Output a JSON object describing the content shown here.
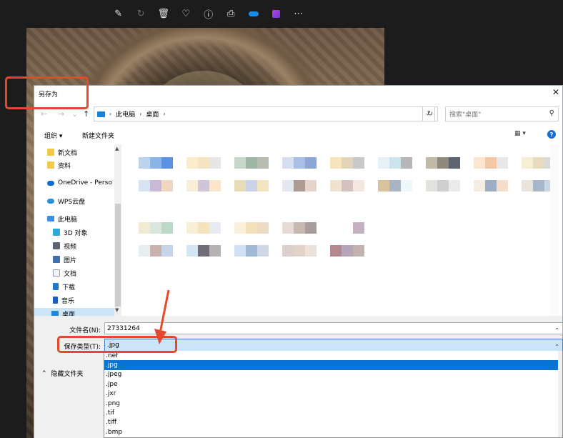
{
  "viewer_toolbar": {
    "icons": [
      "edit-image-icon",
      "rotate-icon",
      "delete-icon",
      "favorite-icon",
      "info-icon",
      "print-icon",
      "onedrive-icon",
      "video-editor-icon",
      "more-icon"
    ]
  },
  "dialog": {
    "title": "另存为",
    "close": "✕",
    "nav": {
      "back": "←",
      "forward": "→",
      "recent": "⌄",
      "up": "↑"
    },
    "breadcrumb": [
      "此电脑",
      "桌面"
    ],
    "breadcrumb_sep": "›",
    "search_placeholder": "搜索\"桌面\"",
    "commands": {
      "organize": "组织 ▾",
      "new_folder": "新建文件夹",
      "view": "▦ ▾",
      "help": "?"
    },
    "nav_items": [
      {
        "label": "新文档",
        "icon": "folder-icon"
      },
      {
        "label": "资料",
        "icon": "folder-icon"
      },
      {
        "label": "OneDrive - Perso",
        "icon": "onedrive-cloud-icon"
      },
      {
        "label": "WPS云盘",
        "icon": "wps-cloud-icon"
      },
      {
        "label": "此电脑",
        "icon": "this-pc-icon"
      },
      {
        "label": "3D 对象",
        "icon": "3d-objects-icon"
      },
      {
        "label": "视频",
        "icon": "videos-icon"
      },
      {
        "label": "图片",
        "icon": "pictures-icon"
      },
      {
        "label": "文档",
        "icon": "documents-icon"
      },
      {
        "label": "下载",
        "icon": "downloads-icon"
      },
      {
        "label": "音乐",
        "icon": "music-icon"
      },
      {
        "label": "桌面",
        "icon": "desktop-icon"
      }
    ],
    "file_name_label": "文件名(N):",
    "file_name_value": "27331264",
    "file_type_label": "保存类型(T):",
    "file_type_value": ".jpg",
    "hide_folders": "隐藏文件夹",
    "file_type_options": [
      ".nef",
      ".jpg",
      ".jpeg",
      ".jpe",
      ".jxr",
      ".png",
      ".tif",
      ".tiff",
      ".bmp"
    ],
    "selected_option_index": 1
  },
  "thumb_colors": [
    [
      "#bcd3ee",
      "#8ab3e6",
      "#5a93e4",
      "#d7e3f2",
      "#c9b8d8",
      "#f1d6c2"
    ],
    [
      "#fbeccb",
      "#f6e3c2",
      "#e6e6e6",
      "#f9efd8",
      "#d0c5d6",
      "#fbe6cc"
    ],
    [
      "#c7d7ca",
      "#9fb6a7",
      "#b8bdb2",
      "#e8dcb8",
      "#c9d3e5",
      "#f2e5c0"
    ],
    [
      "#d6dff0",
      "#a9bfe6",
      "#8ca6d6",
      "#e3e7ef",
      "#b09a94",
      "#e5d5cc"
    ],
    [
      "#f7e4bc",
      "#e3d6b8",
      "#c9c9c9",
      "#eee3cf",
      "#d7c2c2",
      "#f3e7e0"
    ],
    [
      "#e7f2f7",
      "#cbe3ea",
      "#b6b6b6",
      "#d8c39d",
      "#a9b4c6",
      "#eef7fa"
    ],
    [
      "#c0bba8",
      "#8e8a7c",
      "#5f6570",
      "#e4e2dc",
      "#cfcfcf",
      "#eaeaea"
    ],
    [
      "#fce6d0",
      "#f2c9a4",
      "#e8e8e8",
      "#f6ede2",
      "#9daec2",
      "#f4ddc9"
    ],
    [
      "#f7efd4",
      "#e6dbbf",
      "#d9d9d9",
      "#e9e4dc",
      "#a7b7cb",
      "#c9d6e3"
    ],
    [
      "#f3ead4",
      "#d9e7dd",
      "#bcd9c8",
      "#e6eef0",
      "#c8b2ae",
      "#c6d4ea"
    ],
    [
      "#f8efd7",
      "#f3e4bd",
      "#e7eaf0",
      "#d2e7f3",
      "#6f6e78",
      "#b5b1b4"
    ],
    [
      "#f9f1dc",
      "#f2e1b8",
      "#ecdcc4",
      "#d0e0f4",
      "#a0b9d8",
      "#cfd8e6"
    ],
    [
      "#e6dcd5",
      "#c8b9b0",
      "#a99c9c",
      "#dcd0cc",
      "#e1d3c8",
      "#ebe3da"
    ],
    [
      "#ffffff",
      "#ffffff",
      "#c6b0c3",
      "#b3898f",
      "#b4a6b8",
      "#c3b2b0"
    ]
  ]
}
